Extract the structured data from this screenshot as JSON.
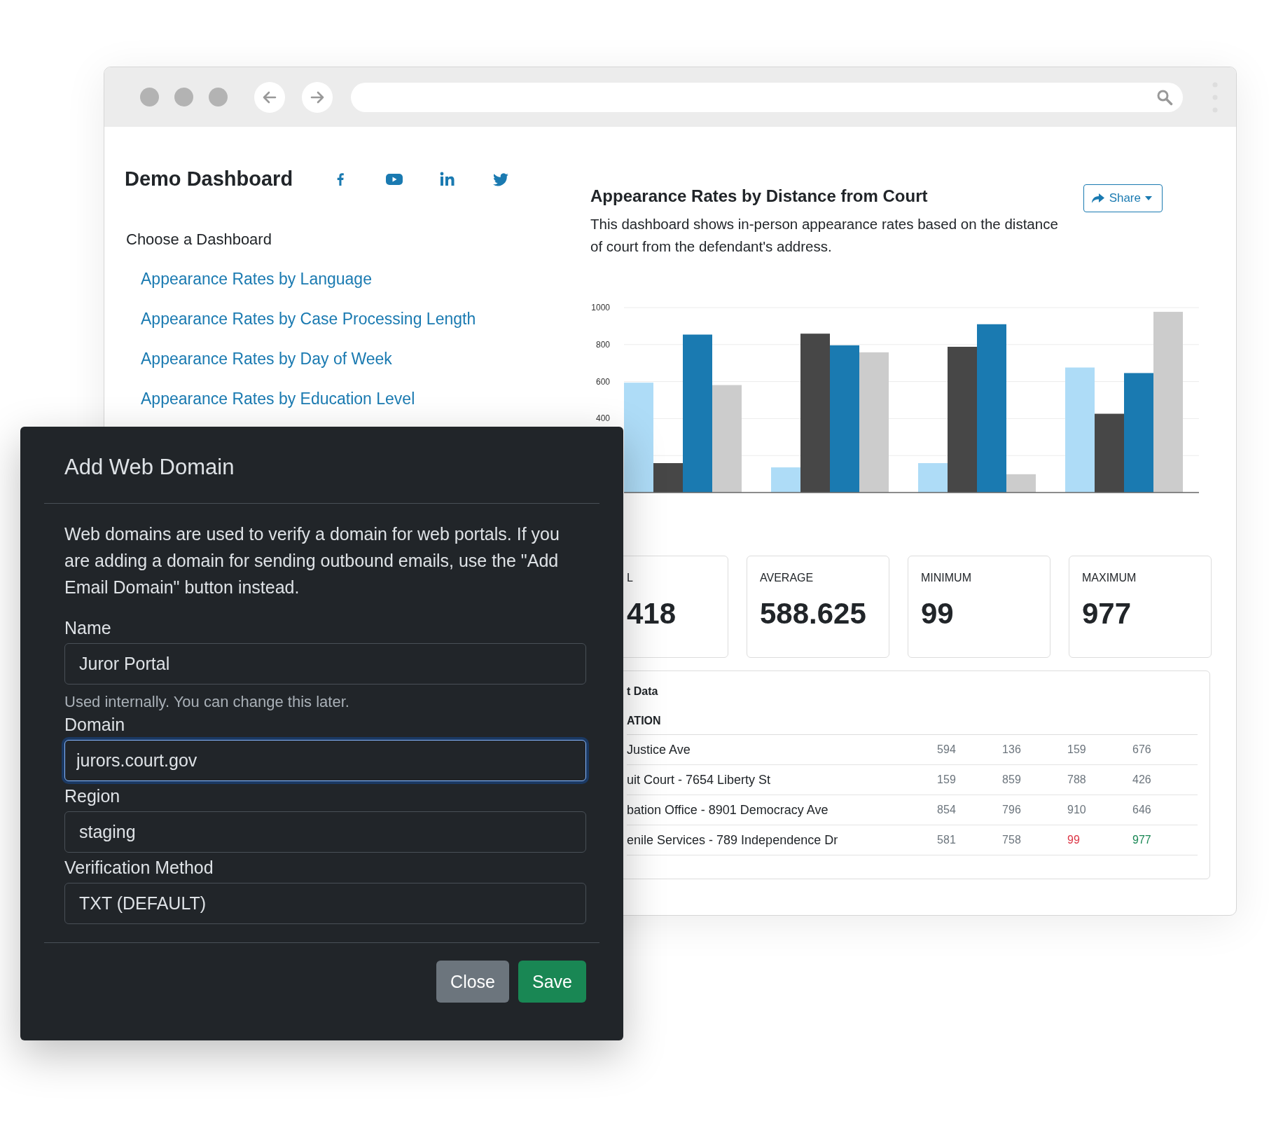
{
  "sidebar": {
    "title": "Demo Dashboard",
    "social": [
      {
        "kind": "facebook"
      },
      {
        "kind": "youtube"
      },
      {
        "kind": "linkedin"
      },
      {
        "kind": "twitter"
      }
    ],
    "heading": "Choose a Dashboard",
    "links": [
      "Appearance Rates by Language",
      "Appearance Rates by Case Processing Length",
      "Appearance Rates by Day of Week",
      "Appearance Rates by Education Level"
    ]
  },
  "main": {
    "title": "Appearance Rates by Distance from Court",
    "share_button": "Share",
    "description": "This dashboard shows in-person appearance rates based on the distance of court from the defendant's address.",
    "chart_data": {
      "type": "bar",
      "grid": true,
      "ylim": [
        0,
        1000
      ],
      "yticks": [
        400,
        600,
        800,
        1000
      ],
      "series": [
        {
          "color": "#aedcf7",
          "values": [
            594,
            136,
            159,
            676
          ]
        },
        {
          "color": "#474747",
          "values": [
            159,
            859,
            788,
            426
          ]
        },
        {
          "color": "#1a7ab1",
          "values": [
            854,
            796,
            910,
            646
          ]
        },
        {
          "color": "#cccccc",
          "values": [
            581,
            758,
            99,
            977
          ]
        }
      ]
    },
    "stats": [
      {
        "label": "L",
        "value": "418"
      },
      {
        "label": "AVERAGE",
        "value": "588.625"
      },
      {
        "label": "MINIMUM",
        "value": "99"
      },
      {
        "label": "MAXIMUM",
        "value": "977"
      }
    ],
    "table": {
      "title": "t Data",
      "column_header": "ATION",
      "rows": [
        {
          "location": "Justice Ave",
          "cells": [
            {
              "text": "594",
              "color": "#6c757d"
            },
            {
              "text": "136",
              "color": "#6c757d"
            },
            {
              "text": "159",
              "color": "#6c757d"
            },
            {
              "text": "676",
              "color": "#6c757d"
            }
          ]
        },
        {
          "location": "uit Court - 7654 Liberty St",
          "cells": [
            {
              "text": "159",
              "color": "#6c757d"
            },
            {
              "text": "859",
              "color": "#6c757d"
            },
            {
              "text": "788",
              "color": "#6c757d"
            },
            {
              "text": "426",
              "color": "#6c757d"
            }
          ]
        },
        {
          "location": "bation Office - 8901 Democracy Ave",
          "cells": [
            {
              "text": "854",
              "color": "#6c757d"
            },
            {
              "text": "796",
              "color": "#6c757d"
            },
            {
              "text": "910",
              "color": "#6c757d"
            },
            {
              "text": "646",
              "color": "#6c757d"
            }
          ]
        },
        {
          "location": "enile Services - 789 Independence Dr",
          "cells": [
            {
              "text": "581",
              "color": "#6c757d"
            },
            {
              "text": "758",
              "color": "#6c757d"
            },
            {
              "text": "99",
              "color": "#dc3545"
            },
            {
              "text": "977",
              "color": "#198754"
            }
          ]
        }
      ]
    }
  },
  "modal": {
    "title": "Add Web Domain",
    "description": "Web domains are used to verify a domain for web portals. If you are adding a domain for sending outbound emails, use the \"Add Email Domain\" button instead.",
    "fields": [
      {
        "label": "Name",
        "value": "Juror Portal",
        "focused": false,
        "help": "Used internally. You can change this later."
      },
      {
        "label": "Domain",
        "value": "jurors.court.gov",
        "focused": true
      },
      {
        "label": "Region",
        "value": "staging",
        "focused": false
      },
      {
        "label": "Verification Method",
        "value": "TXT (DEFAULT)",
        "focused": false
      }
    ],
    "buttons": [
      {
        "label": "Close",
        "kind": "secondary"
      },
      {
        "label": "Save",
        "kind": "primary"
      }
    ]
  }
}
